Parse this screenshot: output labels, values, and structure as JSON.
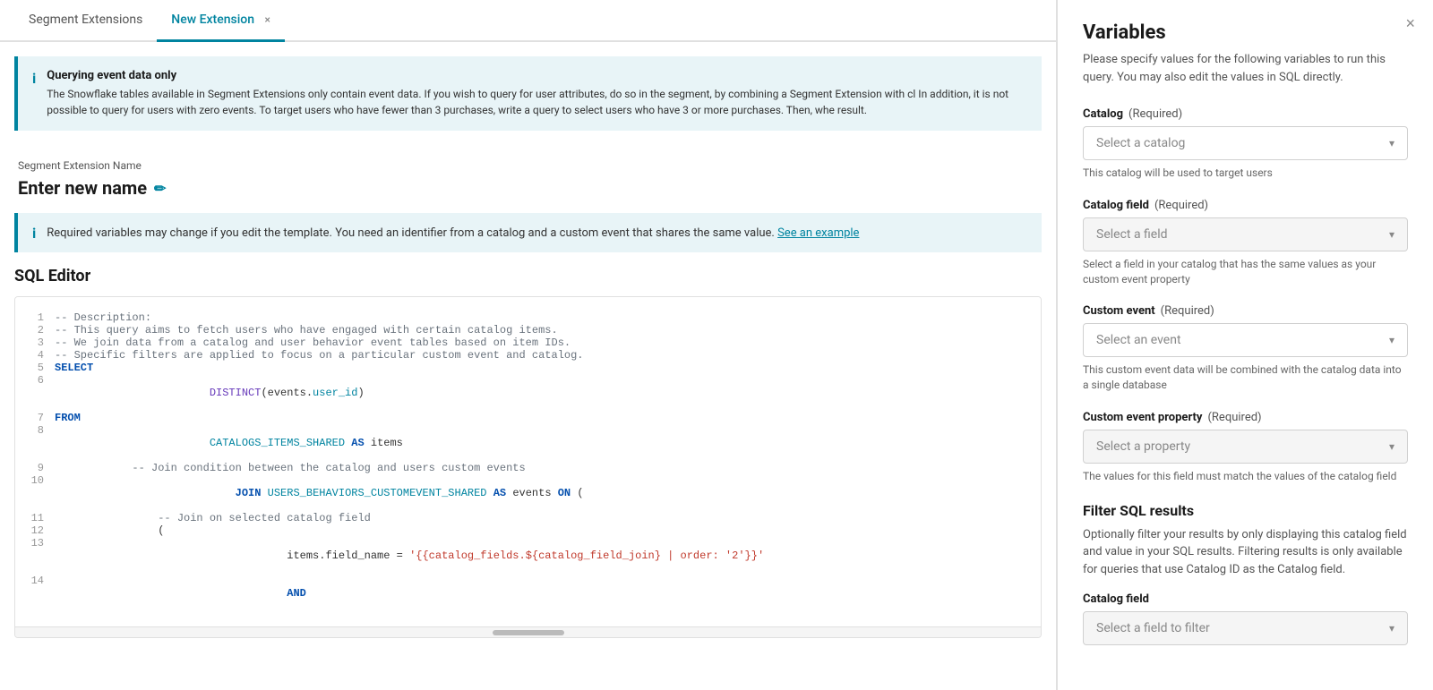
{
  "tabs": [
    {
      "id": "segment-extensions",
      "label": "Segment Extensions",
      "active": false
    },
    {
      "id": "new-extension",
      "label": "New Extension",
      "active": true,
      "closeable": true
    }
  ],
  "info_banner": {
    "title": "Querying event data only",
    "text": "The Snowflake tables available in Segment Extensions only contain event data. If you wish to query for user attributes, do so in the segment, by combining a Segment Extension with cl In addition, it is not possible to query for users with zero events. To target users who have fewer than 3 purchases, write a query to select users who have 3 or more purchases. Then, whe result."
  },
  "name_section": {
    "label": "Segment Extension Name",
    "value": "Enter new name"
  },
  "warning_banner": {
    "text": "Required variables may change if you edit the template. You need an identifier from a catalog and a custom event that shares the same value.",
    "link_text": "See an example"
  },
  "sql_editor": {
    "title": "SQL Editor",
    "lines": [
      {
        "num": 1,
        "parts": [
          {
            "type": "comment",
            "text": "-- Description:"
          }
        ]
      },
      {
        "num": 2,
        "parts": [
          {
            "type": "comment",
            "text": "-- This query aims to fetch users who have engaged with certain catalog items."
          }
        ]
      },
      {
        "num": 3,
        "parts": [
          {
            "type": "comment",
            "text": "-- We join data from a catalog and user behavior event tables based on item IDs."
          }
        ]
      },
      {
        "num": 4,
        "parts": [
          {
            "type": "comment",
            "text": "-- Specific filters are applied to focus on a particular custom event and catalog."
          }
        ]
      },
      {
        "num": 5,
        "parts": [
          {
            "type": "keyword",
            "text": "SELECT"
          }
        ]
      },
      {
        "num": 6,
        "parts": [
          {
            "type": "normal",
            "text": "        "
          },
          {
            "type": "func",
            "text": "DISTINCT"
          },
          {
            "type": "normal",
            "text": "(events."
          },
          {
            "type": "table",
            "text": "user_id"
          },
          {
            "type": "normal",
            "text": ")"
          }
        ]
      },
      {
        "num": 7,
        "parts": [
          {
            "type": "keyword",
            "text": "FROM"
          }
        ]
      },
      {
        "num": 8,
        "parts": [
          {
            "type": "normal",
            "text": "        "
          },
          {
            "type": "table",
            "text": "CATALOGS_ITEMS_SHARED"
          },
          {
            "type": "keyword",
            "text": " AS "
          },
          {
            "type": "normal",
            "text": "items"
          }
        ]
      },
      {
        "num": 9,
        "parts": [
          {
            "type": "normal",
            "text": "            "
          },
          {
            "type": "comment",
            "text": "-- Join condition between the catalog and users custom events"
          }
        ]
      },
      {
        "num": 10,
        "parts": [
          {
            "type": "normal",
            "text": "            "
          },
          {
            "type": "keyword",
            "text": "JOIN"
          },
          {
            "type": "normal",
            "text": " "
          },
          {
            "type": "table",
            "text": "USERS_BEHAVIORS_CUSTOMEVENT_SHARED"
          },
          {
            "type": "keyword",
            "text": " AS "
          },
          {
            "type": "normal",
            "text": "events "
          },
          {
            "type": "keyword",
            "text": "ON"
          },
          {
            "type": "normal",
            "text": " ("
          }
        ]
      },
      {
        "num": 11,
        "parts": [
          {
            "type": "normal",
            "text": "                "
          },
          {
            "type": "comment",
            "text": "-- Join on selected catalog field"
          }
        ]
      },
      {
        "num": 12,
        "parts": [
          {
            "type": "normal",
            "text": "                ("
          }
        ]
      },
      {
        "num": 13,
        "parts": [
          {
            "type": "normal",
            "text": "                    items.field_name = "
          },
          {
            "type": "string",
            "text": "'{{catalog_fields.${catalog_field_join} | order: '2'}}'"
          }
        ]
      },
      {
        "num": 14,
        "parts": [
          {
            "type": "normal",
            "text": "                    "
          },
          {
            "type": "keyword",
            "text": "AND"
          }
        ]
      }
    ]
  },
  "right_panel": {
    "title": "Variables",
    "subtitle": "Please specify values for the following variables to run this query. You may also edit the values in SQL directly.",
    "close_label": "×",
    "fields": [
      {
        "id": "catalog",
        "label": "Catalog",
        "required": true,
        "placeholder": "Select a catalog",
        "hint": "This catalog will be used to target users"
      },
      {
        "id": "catalog-field",
        "label": "Catalog field",
        "required": true,
        "placeholder": "Select a field",
        "hint": "Select a field in your catalog that has the same values as your custom event property"
      },
      {
        "id": "custom-event",
        "label": "Custom event",
        "required": true,
        "placeholder": "Select an event",
        "hint": "This custom event data will be combined with the catalog data into a single database"
      },
      {
        "id": "custom-event-property",
        "label": "Custom event property",
        "required": true,
        "placeholder": "Select a property",
        "hint": "The values for this field must match the values of the catalog field"
      }
    ],
    "filter_section": {
      "title": "Filter SQL results",
      "description": "Optionally filter your results by only displaying this catalog field and value in your SQL results. Filtering results is only available for queries that use Catalog ID as the Catalog field.",
      "catalog_field_label": "Catalog field",
      "catalog_field_placeholder": "Select a field to filter"
    }
  }
}
